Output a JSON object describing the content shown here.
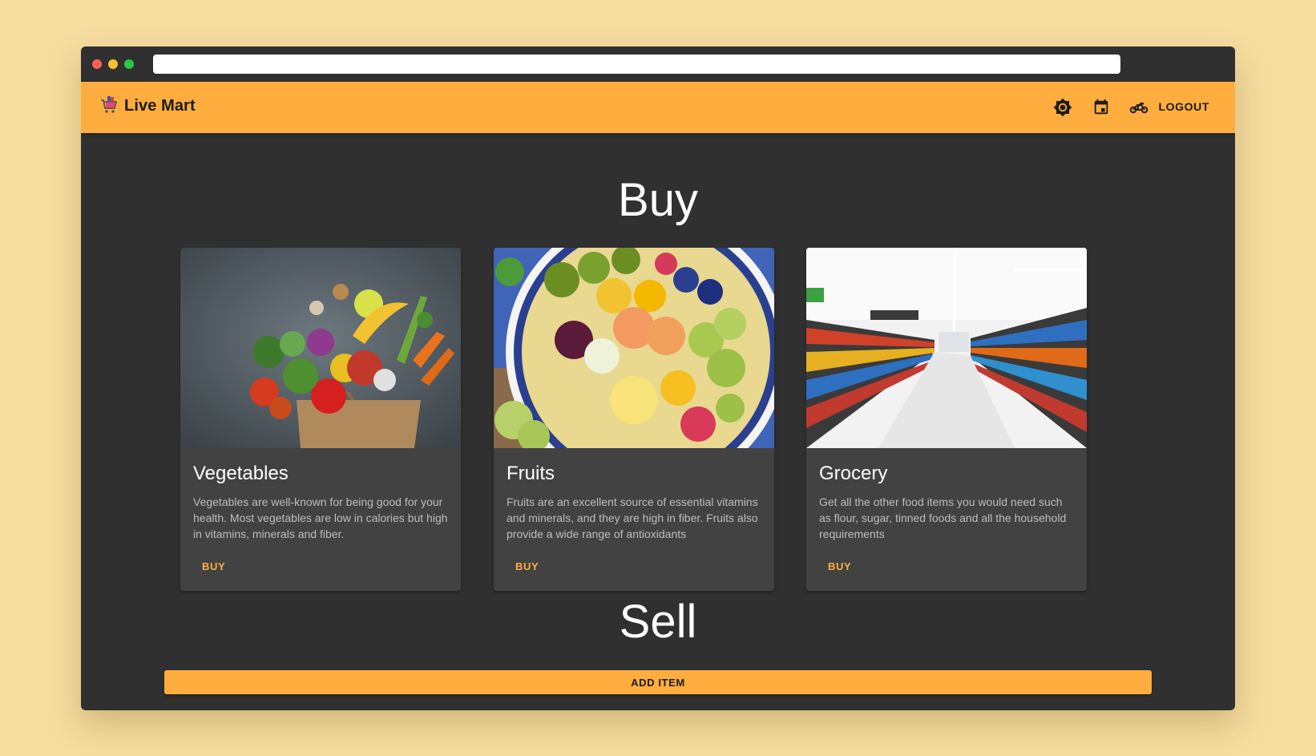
{
  "app": {
    "brand": "Live Mart",
    "logout_label": "LOGOUT",
    "accent_color": "#ffad3f",
    "background_color": "#303030",
    "card_color": "#424242"
  },
  "toolbar": {
    "icons": [
      "theme-toggle-icon",
      "calendar-icon",
      "delivery-bike-icon"
    ]
  },
  "buy_section": {
    "heading": "Buy",
    "cards": [
      {
        "title": "Vegetables",
        "description": "Vegetables are well-known for being good for your health. Most vegetables are low in calories but high in vitamins, minerals and fiber.",
        "button_label": "BUY",
        "image": "vegetables-in-paper-bag"
      },
      {
        "title": "Fruits",
        "description": "Fruits are an excellent source of essential vitamins and minerals, and they are high in fiber. Fruits also provide a wide range of antioxidants",
        "button_label": "BUY",
        "image": "fruit-platter"
      },
      {
        "title": "Grocery",
        "description": "Get all the other food items you would need such as flour, sugar, tinned foods and all the household requirements",
        "button_label": "BUY",
        "image": "supermarket-aisle"
      }
    ]
  },
  "sell_section": {
    "heading": "Sell",
    "add_item_label": "ADD ITEM"
  }
}
